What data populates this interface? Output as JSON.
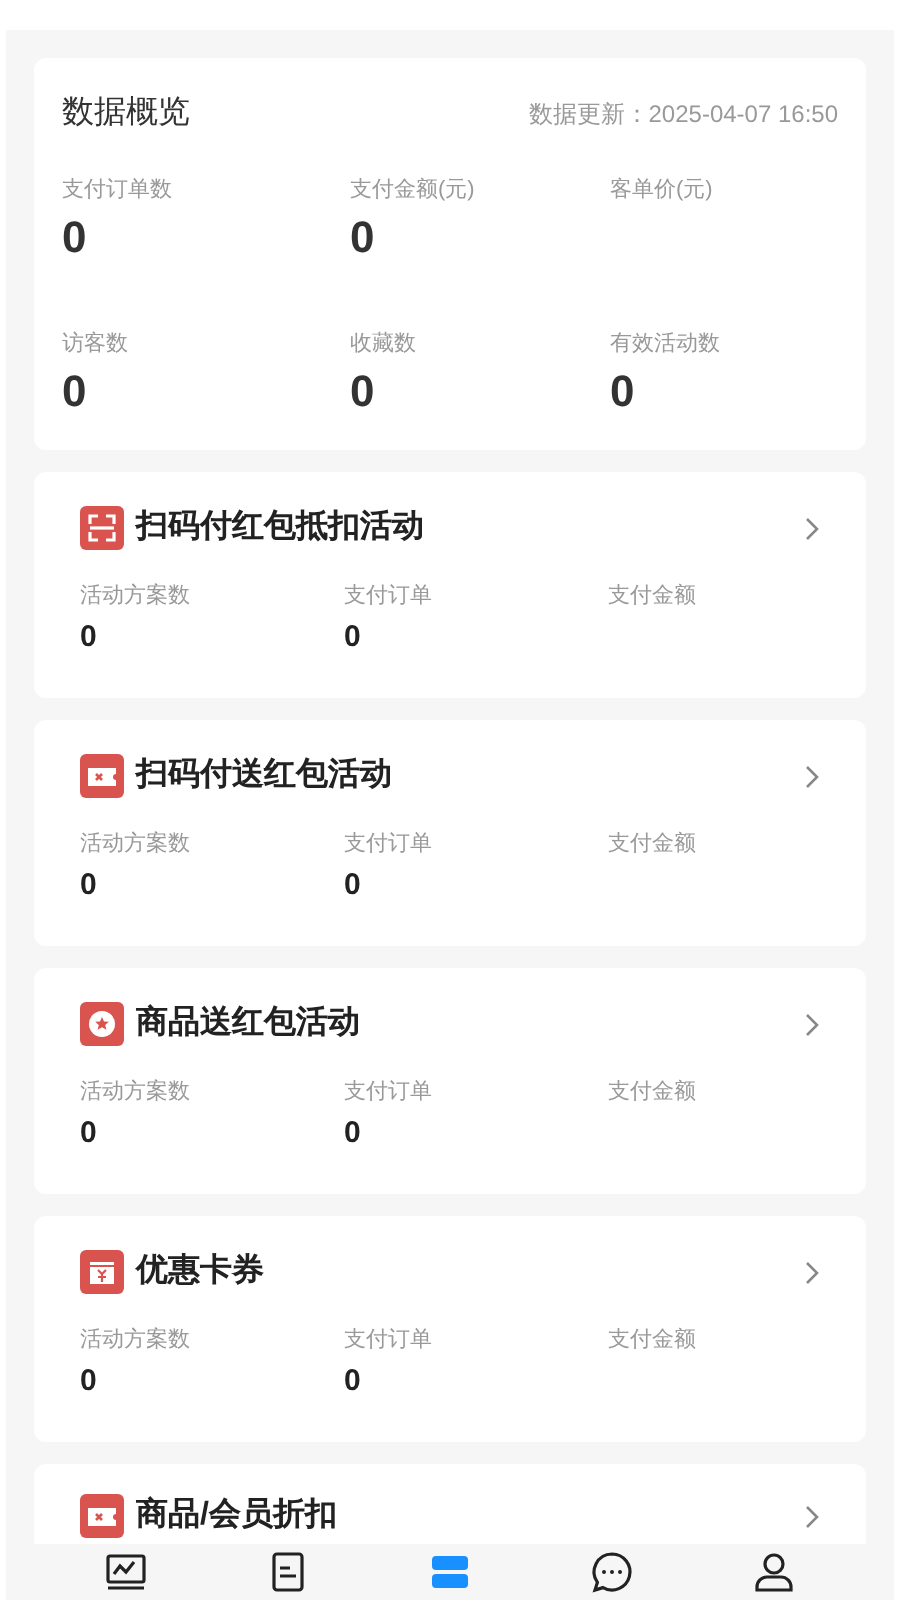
{
  "overview": {
    "title": "数据概览",
    "updated": "数据更新：2025-04-07 16:50",
    "stats": [
      {
        "label": "支付订单数",
        "value": "0"
      },
      {
        "label": "支付金额(元)",
        "value": "0"
      },
      {
        "label": "客单价(元)"
      },
      {
        "label": "访客数",
        "value": "0"
      },
      {
        "label": "收藏数",
        "value": "0"
      },
      {
        "label": "有效活动数",
        "value": "0"
      }
    ]
  },
  "activities": [
    {
      "title": "扫码付红包抵扣活动",
      "metrics": [
        {
          "label": "活动方案数",
          "value": "0"
        },
        {
          "label": "支付订单",
          "value": "0"
        },
        {
          "label": "支付金额"
        }
      ]
    },
    {
      "title": "扫码付送红包活动",
      "metrics": [
        {
          "label": "活动方案数",
          "value": "0"
        },
        {
          "label": "支付订单",
          "value": "0"
        },
        {
          "label": "支付金额"
        }
      ]
    },
    {
      "title": "商品送红包活动",
      "metrics": [
        {
          "label": "活动方案数",
          "value": "0"
        },
        {
          "label": "支付订单",
          "value": "0"
        },
        {
          "label": "支付金额"
        }
      ]
    },
    {
      "title": "优惠卡券",
      "metrics": [
        {
          "label": "活动方案数",
          "value": "0"
        },
        {
          "label": "支付订单",
          "value": "0"
        },
        {
          "label": "支付金额"
        }
      ]
    },
    {
      "title": "商品/会员折扣"
    }
  ],
  "tabs": [
    {
      "selected": false
    },
    {
      "selected": false
    },
    {
      "selected": true
    },
    {
      "selected": false
    },
    {
      "selected": false
    }
  ]
}
